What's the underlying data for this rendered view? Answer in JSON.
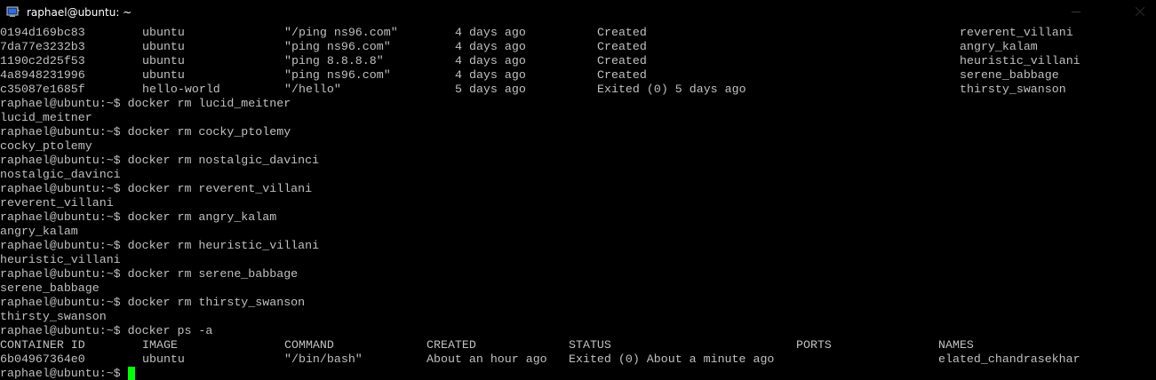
{
  "window": {
    "title": "raphael@ubuntu: ~",
    "app_icon": "putty-icon",
    "buttons": [
      "minimize-icon",
      "maximize-icon",
      "close-icon"
    ]
  },
  "colors": {
    "background": "#000000",
    "text": "#c0c0c0",
    "title_text": "#ffffff",
    "cursor": "#00ff00"
  },
  "prev_rows": [
    [
      "0194d169bc83",
      "ubuntu",
      "\"/ping ns96.com\"",
      "4 days ago",
      "Created",
      "reverent_villani"
    ],
    [
      "7da77e3232b3",
      "ubuntu",
      "\"ping ns96.com\"",
      "4 days ago",
      "Created",
      "angry_kalam"
    ],
    [
      "1190c2d25f53",
      "ubuntu",
      "\"ping 8.8.8.8\"",
      "4 days ago",
      "Created",
      "heuristic_villani"
    ],
    [
      "4a8948231996",
      "ubuntu",
      "\"ping ns96.com\"",
      "4 days ago",
      "Created",
      "serene_babbage"
    ],
    [
      "c35087e1685f",
      "hello-world",
      "\"/hello\"",
      "5 days ago",
      "Exited (0) 5 days ago",
      "thirsty_swanson"
    ]
  ],
  "prompt": "raphael@ubuntu:~$",
  "commands": [
    {
      "cmd": "docker rm lucid_meitner",
      "out": "lucid_meitner"
    },
    {
      "cmd": "docker rm cocky_ptolemy",
      "out": "cocky_ptolemy"
    },
    {
      "cmd": "docker rm nostalgic_davinci",
      "out": "nostalgic_davinci"
    },
    {
      "cmd": "docker rm reverent_villani",
      "out": "reverent_villani"
    },
    {
      "cmd": "docker rm angry_kalam",
      "out": "angry_kalam"
    },
    {
      "cmd": "docker rm heuristic_villani",
      "out": "heuristic_villani"
    },
    {
      "cmd": "docker rm serene_babbage",
      "out": "serene_babbage"
    },
    {
      "cmd": "docker rm thirsty_swanson",
      "out": "thirsty_swanson"
    }
  ],
  "ps_command": "docker ps -a",
  "ps_headers": [
    "CONTAINER ID",
    "IMAGE",
    "COMMAND",
    "CREATED",
    "STATUS",
    "PORTS",
    "NAMES"
  ],
  "ps_row": [
    "6b04967364e0",
    "ubuntu",
    "\"/bin/bash\"",
    "About an hour ago",
    "Exited (0) About a minute ago",
    "",
    "elated_chandrasekhar"
  ]
}
